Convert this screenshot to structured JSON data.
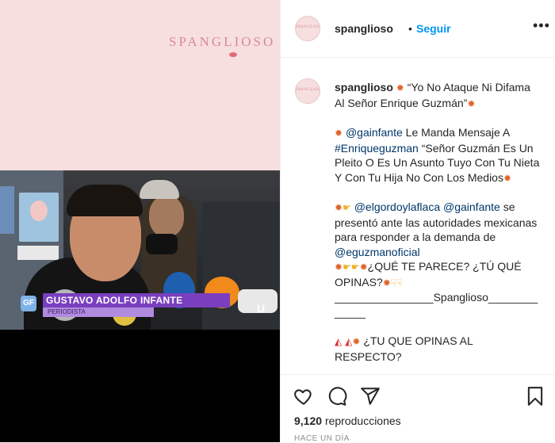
{
  "media": {
    "brand_text": "SPANGLIOSO",
    "lower_third_name": "GUSTAVO ADOLFO INFANTE",
    "lower_third_role": "PERIODISTA",
    "channel_logo": "U",
    "corner_logo": "GF"
  },
  "header": {
    "avatar_text": "SPANGLIOSO",
    "username": "spanglioso",
    "separator": "•",
    "follow_label": "Seguir",
    "more_label": "•••"
  },
  "caption": {
    "avatar_text": "SPANGLIOSO",
    "username": "spanglioso",
    "line1": "“Yo No Ataque Ni Difama Al Señor Enrique Guzmán”",
    "p2_mention": "@gainfante",
    "p2_text_a": "Le Manda Mensaje A",
    "p2_hashtag": "#Enriqueguzman",
    "p2_text_b": "“Señor Guzmán Es Un Pleito O Es Un Asunto Tuyo Con Tu Nieta Y Con Tu Hija No Con Los Medios",
    "p3_mention1": "@elgordoylaflaca",
    "p3_mention2": "@gainfante",
    "p3_text_a": "se presentó ante las autoridades mexicanas para responder a la demanda de",
    "p3_mention3": "@eguzmanoficial",
    "p3_question": "¿QUÉ TE PARECE? ¿TÚ QUÉ OPINAS?",
    "p3_signature": "________________Spanglioso_____________",
    "p4_text": "¿TU QUE OPINAS AL RESPECTO?"
  },
  "actions": {
    "views_count": "9,120",
    "views_label": "reproducciones",
    "time": "HACE UN DÍA"
  },
  "icons": [
    "like-icon",
    "comment-icon",
    "share-icon",
    "bookmark-icon",
    "more-icon"
  ],
  "colors": {
    "link": "#00376b",
    "follow": "#0095f6",
    "accent_pink": "#f7dfe0"
  }
}
